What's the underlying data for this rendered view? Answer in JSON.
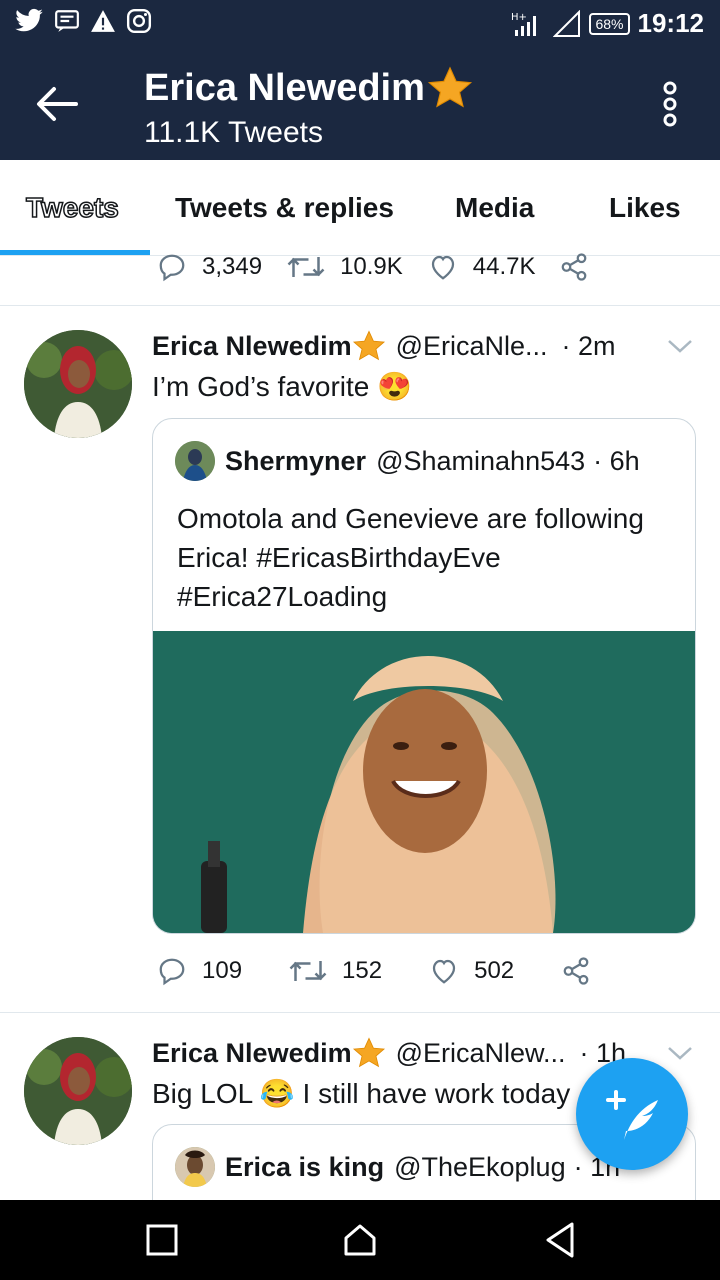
{
  "status_bar": {
    "battery": "68%",
    "time": "19:12",
    "network": "H+",
    "left_icons": [
      "twitter-icon",
      "message-icon",
      "warning-icon",
      "instagram-icon"
    ]
  },
  "header": {
    "name": "Erica Nlewedim",
    "tweet_count": "11.1K Tweets"
  },
  "tabs": [
    {
      "label": "Tweets",
      "active": true
    },
    {
      "label": "Tweets & replies",
      "active": false
    },
    {
      "label": "Media",
      "active": false
    },
    {
      "label": "Likes",
      "active": false
    }
  ],
  "prev_tweet_actions": {
    "replies": "3,349",
    "retweets": "10.9K",
    "likes": "44.7K"
  },
  "tweets": [
    {
      "name": "Erica Nlewedim",
      "handle": "@EricaNle...",
      "time": "· 2m",
      "text": "I’m God’s favorite 😍",
      "quote": {
        "name": "Shermyner",
        "handle": "@Shaminahn543",
        "time": "· 6h",
        "text": "Omotola and Genevieve are following Erica! #EricasBirthdayEve #Erica27Loading"
      },
      "replies": "109",
      "retweets": "152",
      "likes": "502"
    },
    {
      "name": "Erica Nlewedim",
      "handle": "@EricaNlew...",
      "time": "· 1h",
      "text": "Big LOL 😂 I still have work today",
      "quote": {
        "name": "Erica is king",
        "handle": "@TheEkoplug",
        "time": "· 1h"
      }
    }
  ],
  "colors": {
    "header_bg": "#1b2840",
    "accent": "#1da1f2",
    "star": "#f5a623"
  }
}
